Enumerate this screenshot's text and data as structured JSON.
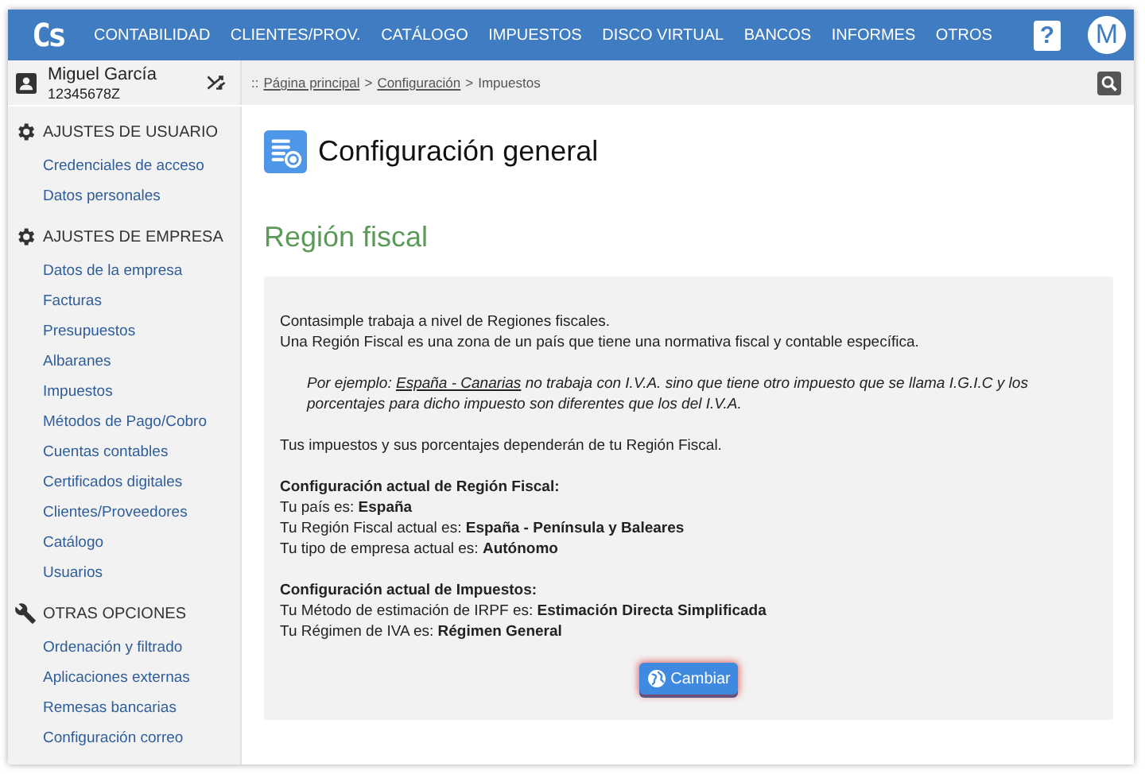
{
  "topbar": {
    "logo": "Cs",
    "menu": [
      "CONTABILIDAD",
      "CLIENTES/PROV.",
      "CATÁLOGO",
      "IMPUESTOS",
      "DISCO VIRTUAL",
      "BANCOS",
      "INFORMES",
      "OTROS"
    ],
    "help": "?",
    "avatar": "M"
  },
  "user": {
    "name": "Miguel García",
    "id": "12345678Z"
  },
  "sidebar": [
    {
      "title": "AJUSTES DE USUARIO",
      "kind": "gear",
      "items": [
        "Credenciales de acceso",
        "Datos personales"
      ]
    },
    {
      "title": "AJUSTES DE EMPRESA",
      "kind": "gear",
      "items": [
        "Datos de la empresa",
        "Facturas",
        "Presupuestos",
        "Albaranes",
        "Impuestos",
        "Métodos de Pago/Cobro",
        "Cuentas contables",
        "Certificados digitales",
        "Clientes/Proveedores",
        "Catálogo",
        "Usuarios"
      ]
    },
    {
      "title": "OTRAS OPCIONES",
      "kind": "wrench",
      "items": [
        "Ordenación y filtrado",
        "Aplicaciones externas",
        "Remesas bancarias",
        "Configuración correo"
      ]
    }
  ],
  "breadcrumb": {
    "prefix": "::",
    "separator": ">",
    "items": [
      {
        "label": "Página principal",
        "kind": "link"
      },
      {
        "label": "Configuración",
        "kind": "link"
      },
      {
        "label": "Impuestos",
        "kind": "current"
      }
    ]
  },
  "page_title": "Configuración general",
  "section_title": "Región fiscal",
  "panel": {
    "intro": [
      "Contasimple trabaja a nivel de Regiones fiscales.",
      "Una Región Fiscal es una zona de un país que tiene una normativa fiscal y contable específica."
    ],
    "example": {
      "prefix": "Por ejemplo:",
      "link": "España - Canarias",
      "rest": "no trabaja con I.V.A. sino que tiene otro impuesto que se llama I.G.I.C y los porcentajes para dicho impuesto son diferentes que los del I.V.A."
    },
    "note": "Tus impuestos y sus porcentajes dependerán de tu Región Fiscal.",
    "groups": [
      {
        "heading": "Configuración actual de Región Fiscal:",
        "lines": [
          "Tu país es: **España**",
          "Tu Región Fiscal actual es: **España - Península y Baleares**",
          "Tu tipo de empresa actual es: **Autónomo**"
        ]
      },
      {
        "heading": "Configuración actual de Impuestos:",
        "lines": [
          "Tu Método de estimación de IRPF es: **Estimación Directa Simplificada**",
          "Tu Régimen de IVA es: **Régimen General**"
        ]
      }
    ],
    "button": "Cambiar"
  }
}
